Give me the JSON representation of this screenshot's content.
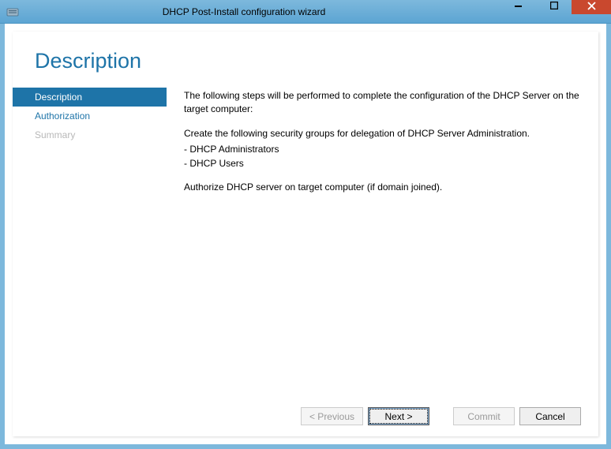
{
  "window": {
    "title": "DHCP Post-Install configuration wizard"
  },
  "header": {
    "title": "Description"
  },
  "sidebar": {
    "items": [
      {
        "label": "Description",
        "state": "active"
      },
      {
        "label": "Authorization",
        "state": "normal"
      },
      {
        "label": "Summary",
        "state": "disabled"
      }
    ]
  },
  "main": {
    "intro": "The following steps will be performed to complete the configuration of the DHCP Server on the target computer:",
    "groups_intro": "Create the following security groups for delegation of DHCP Server Administration.",
    "group1": "- DHCP Administrators",
    "group2": "- DHCP Users",
    "authorize": "Authorize DHCP server on target computer (if domain joined)."
  },
  "buttons": {
    "previous": "< Previous",
    "next": "Next >",
    "commit": "Commit",
    "cancel": "Cancel"
  }
}
